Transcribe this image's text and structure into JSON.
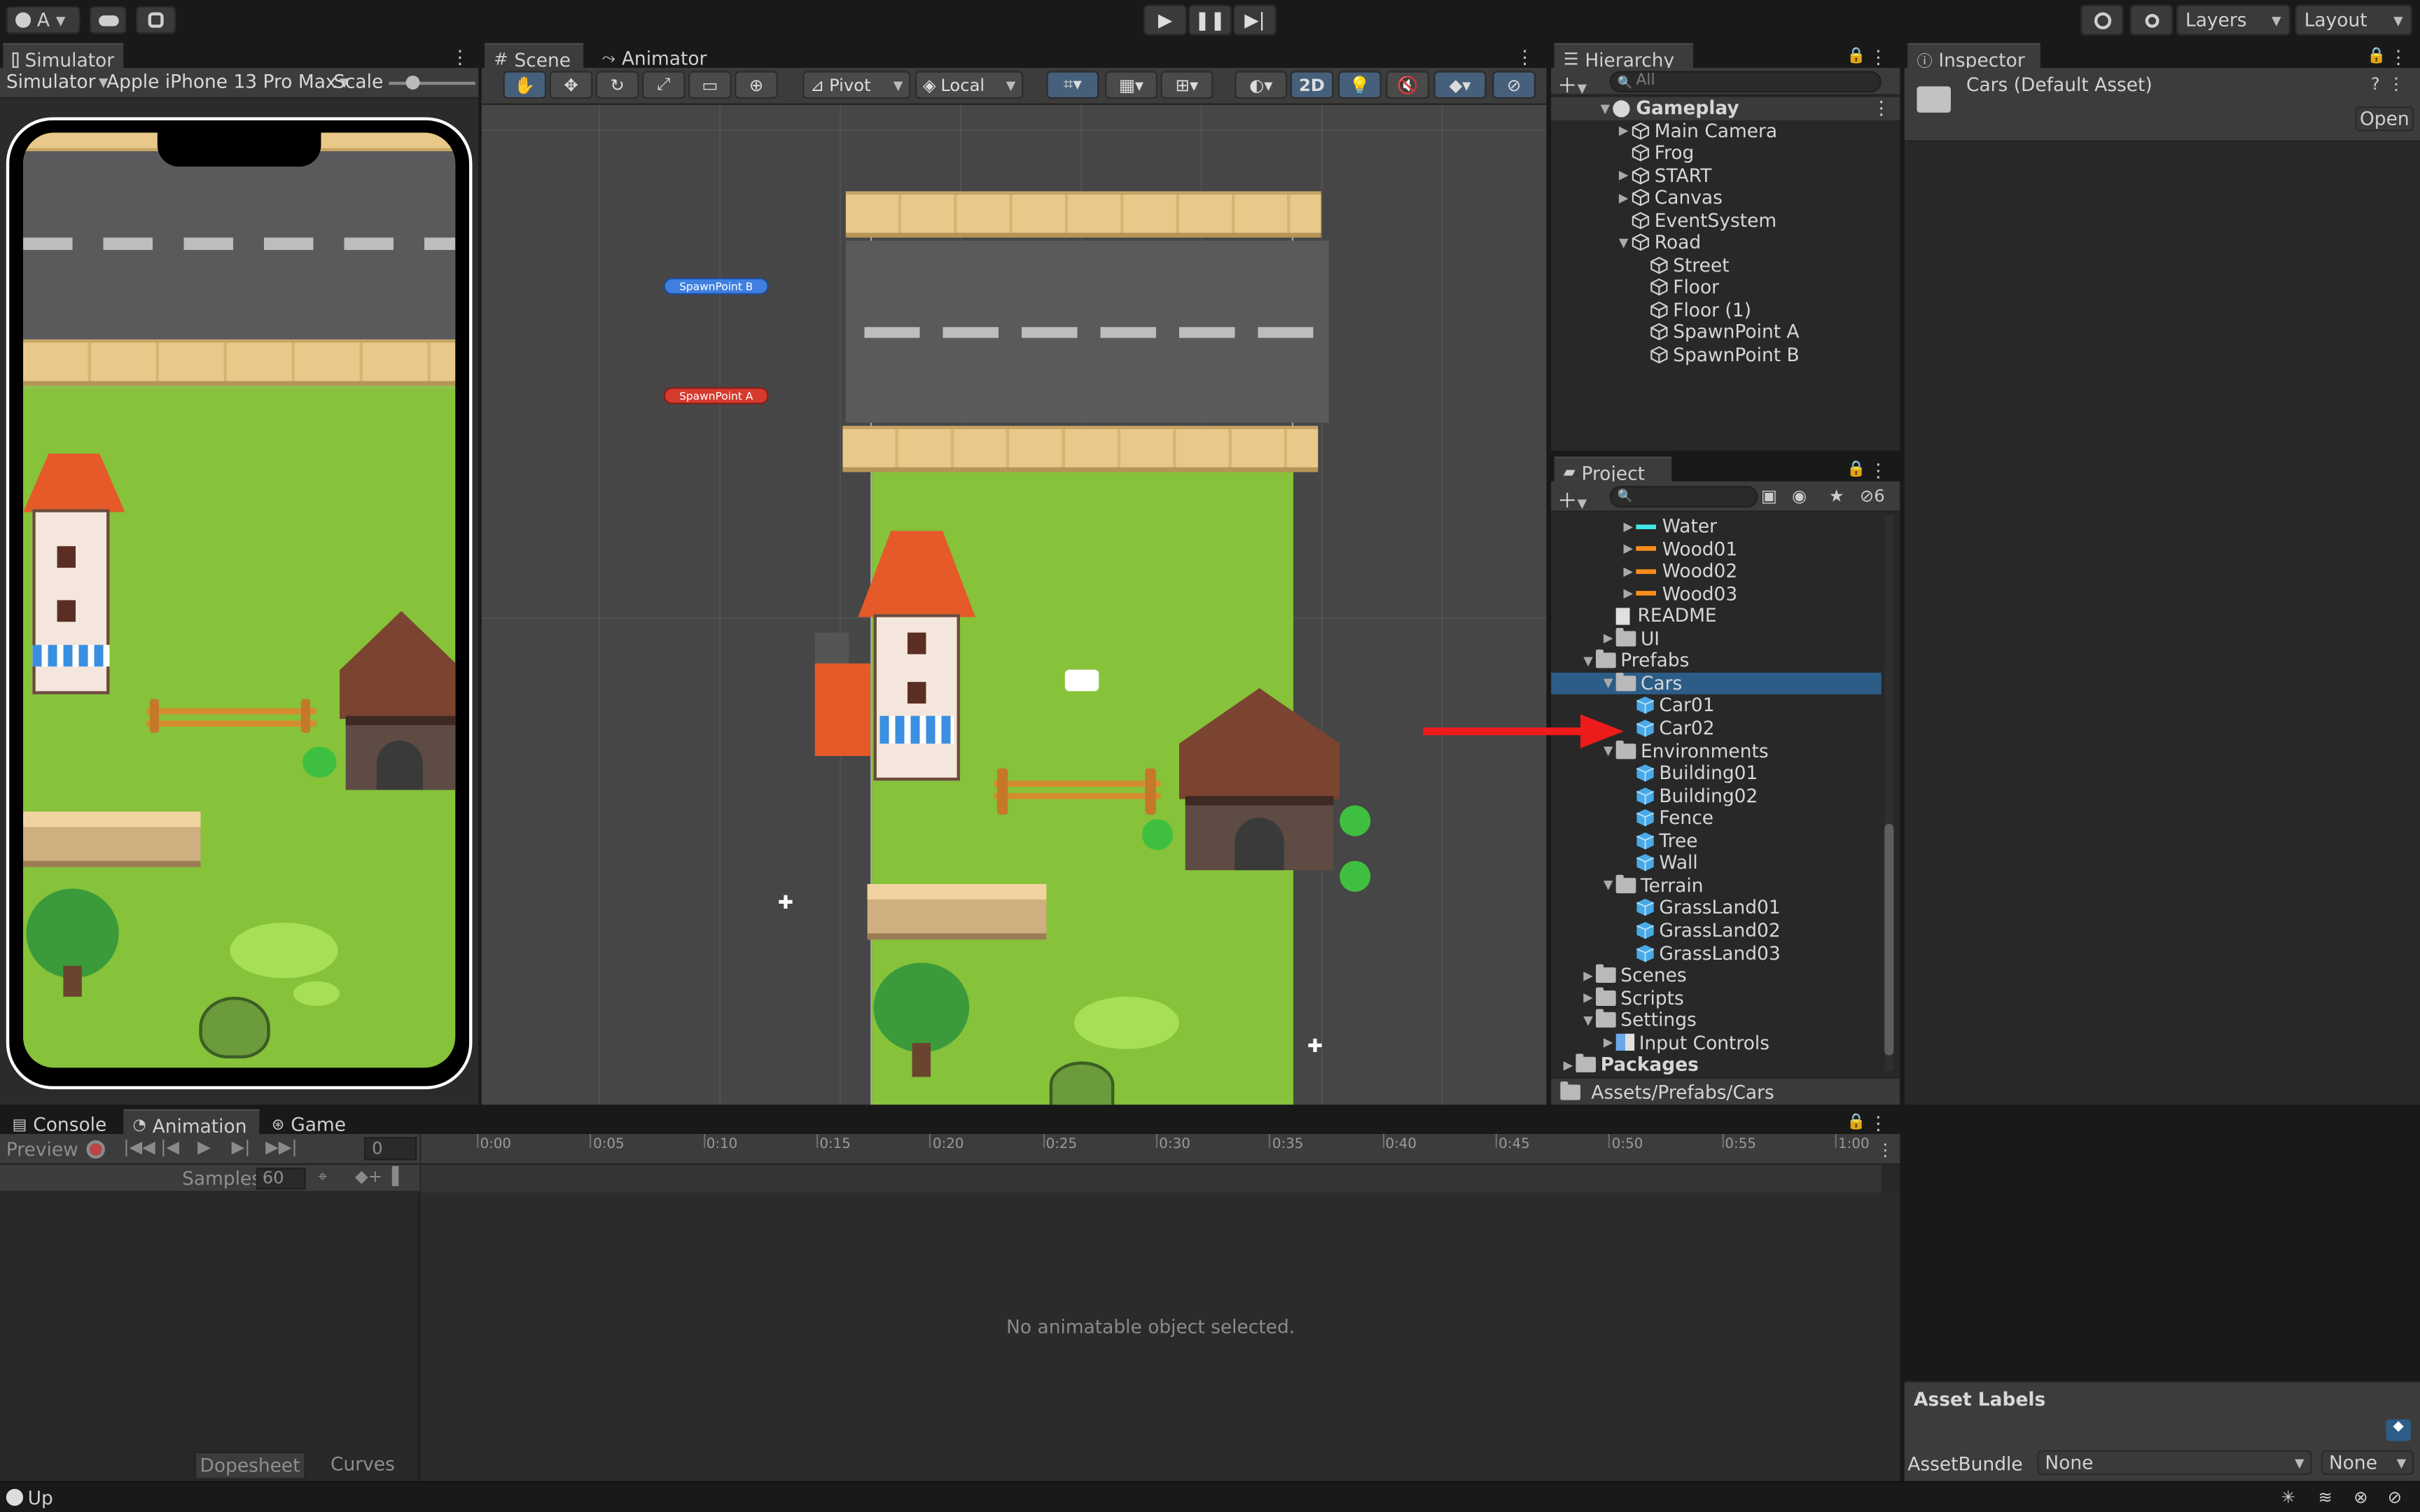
{
  "topbar": {
    "account_label": "A",
    "layers_label": "Layers",
    "layout_label": "Layout"
  },
  "simulator": {
    "tab_label": "Simulator",
    "mode_label": "Simulator",
    "device_label": "Apple iPhone 13 Pro Max",
    "scale_label": "Scale",
    "scale_value": 0.1
  },
  "scene": {
    "tab_scene": "Scene",
    "tab_animator": "Animator",
    "pivot_label": "Pivot",
    "local_label": "Local",
    "mode_2d": "2D",
    "spawn_b": "SpawnPoint B",
    "spawn_a": "SpawnPoint A"
  },
  "hierarchy": {
    "tab_label": "Hierarchy",
    "search_placeholder": "All",
    "scene_name": "Gameplay",
    "items": [
      {
        "label": "Main Camera",
        "depth": 1,
        "arrow": "right"
      },
      {
        "label": "Frog",
        "depth": 1,
        "arrow": "none"
      },
      {
        "label": "START",
        "depth": 1,
        "arrow": "right"
      },
      {
        "label": "Canvas",
        "depth": 1,
        "arrow": "right"
      },
      {
        "label": "EventSystem",
        "depth": 1,
        "arrow": "none"
      },
      {
        "label": "Road",
        "depth": 1,
        "arrow": "down"
      },
      {
        "label": "Street",
        "depth": 2,
        "arrow": "none"
      },
      {
        "label": "Floor",
        "depth": 2,
        "arrow": "none"
      },
      {
        "label": "Floor (1)",
        "depth": 2,
        "arrow": "none"
      },
      {
        "label": "SpawnPoint A",
        "depth": 2,
        "arrow": "none"
      },
      {
        "label": "SpawnPoint B",
        "depth": 2,
        "arrow": "none"
      }
    ]
  },
  "project": {
    "tab_label": "Project",
    "hidden_count": "6",
    "path_label": "Assets/Prefabs/Cars",
    "items": [
      {
        "label": "Water",
        "depth": 3,
        "arrow": "right",
        "icon": "material",
        "color": "#3fe6e6"
      },
      {
        "label": "Wood01",
        "depth": 3,
        "arrow": "right",
        "icon": "material",
        "color": "#ff8c1a"
      },
      {
        "label": "Wood02",
        "depth": 3,
        "arrow": "right",
        "icon": "material",
        "color": "#ff8c1a"
      },
      {
        "label": "Wood03",
        "depth": 3,
        "arrow": "right",
        "icon": "material",
        "color": "#ff8c1a"
      },
      {
        "label": "README",
        "depth": 2,
        "arrow": "none",
        "icon": "doc"
      },
      {
        "label": "UI",
        "depth": 2,
        "arrow": "right",
        "icon": "folder"
      },
      {
        "label": "Prefabs",
        "depth": 1,
        "arrow": "down",
        "icon": "folder-open"
      },
      {
        "label": "Cars",
        "depth": 2,
        "arrow": "down",
        "icon": "folder-open",
        "selected": true
      },
      {
        "label": "Car01",
        "depth": 3,
        "arrow": "none",
        "icon": "prefab"
      },
      {
        "label": "Car02",
        "depth": 3,
        "arrow": "none",
        "icon": "prefab"
      },
      {
        "label": "Environments",
        "depth": 2,
        "arrow": "down",
        "icon": "folder-open"
      },
      {
        "label": "Building01",
        "depth": 3,
        "arrow": "none",
        "icon": "prefab"
      },
      {
        "label": "Building02",
        "depth": 3,
        "arrow": "none",
        "icon": "prefab"
      },
      {
        "label": "Fence",
        "depth": 3,
        "arrow": "none",
        "icon": "prefab"
      },
      {
        "label": "Tree",
        "depth": 3,
        "arrow": "none",
        "icon": "prefab"
      },
      {
        "label": "Wall",
        "depth": 3,
        "arrow": "none",
        "icon": "prefab"
      },
      {
        "label": "Terrain",
        "depth": 2,
        "arrow": "down",
        "icon": "folder-open"
      },
      {
        "label": "GrassLand01",
        "depth": 3,
        "arrow": "none",
        "icon": "prefab"
      },
      {
        "label": "GrassLand02",
        "depth": 3,
        "arrow": "none",
        "icon": "prefab"
      },
      {
        "label": "GrassLand03",
        "depth": 3,
        "arrow": "none",
        "icon": "prefab"
      },
      {
        "label": "Scenes",
        "depth": 1,
        "arrow": "right",
        "icon": "folder"
      },
      {
        "label": "Scripts",
        "depth": 1,
        "arrow": "right",
        "icon": "folder"
      },
      {
        "label": "Settings",
        "depth": 1,
        "arrow": "down",
        "icon": "folder-open"
      },
      {
        "label": "Input Controls",
        "depth": 2,
        "arrow": "right",
        "icon": "input"
      },
      {
        "label": "Packages",
        "depth": 0,
        "arrow": "right",
        "icon": "folder",
        "bold": true
      }
    ]
  },
  "inspector": {
    "tab_label": "Inspector",
    "asset_title": "Cars (Default Asset)",
    "open_label": "Open",
    "asset_labels_heading": "Asset Labels",
    "assetbundle_label": "AssetBundle",
    "assetbundle_value": "None",
    "variant_value": "None"
  },
  "bottom": {
    "tab_console": "Console",
    "tab_animation": "Animation",
    "tab_game": "Game",
    "preview_label": "Preview",
    "frame_value": "0",
    "samples_label": "Samples",
    "samples_value": "60",
    "timeline_ticks": [
      "0:00",
      "0:05",
      "0:10",
      "0:15",
      "0:20",
      "0:25",
      "0:30",
      "0:35",
      "0:40",
      "0:45",
      "0:50",
      "0:55",
      "1:00"
    ],
    "empty_message": "No animatable object selected.",
    "dopesheet_label": "Dopesheet",
    "curves_label": "Curves"
  },
  "statusbar": {
    "text": "Up"
  }
}
